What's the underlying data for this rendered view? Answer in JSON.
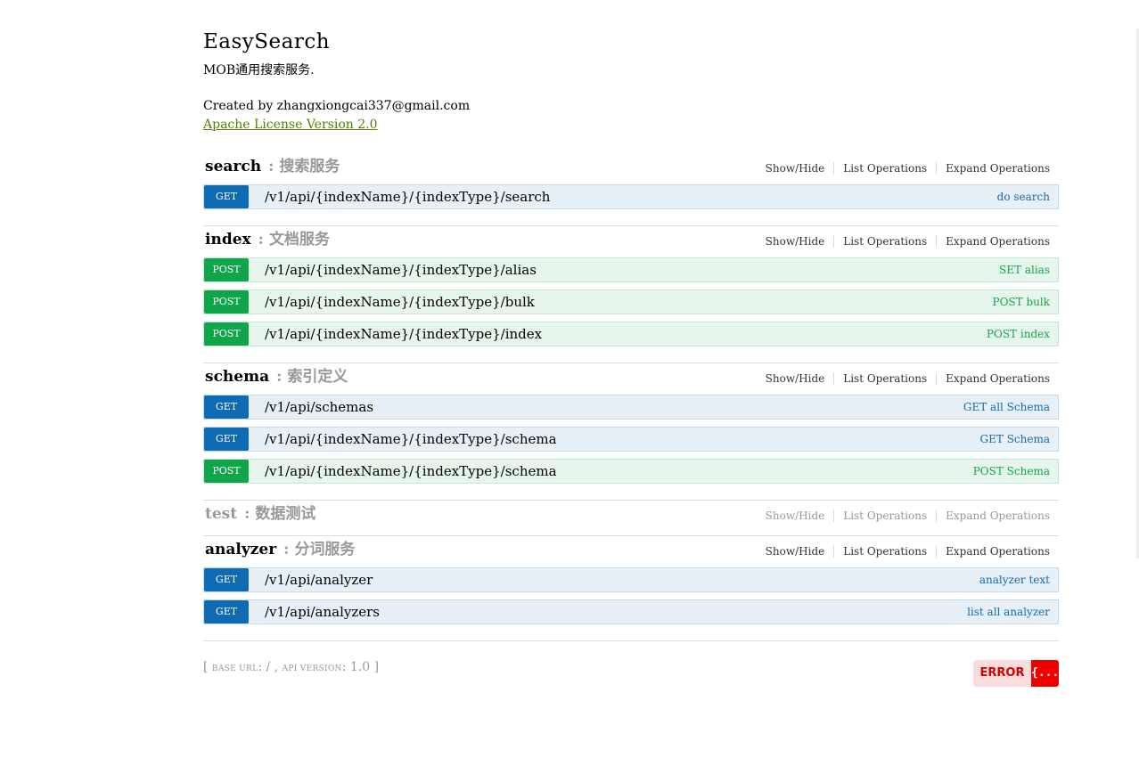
{
  "info": {
    "title": "EasySearch",
    "description": "MOB通用搜索服务.",
    "created": "Created by zhangxiongcai337@gmail.com",
    "license": "Apache License Version 2.0"
  },
  "links": {
    "show_hide": "Show/Hide",
    "list_operations": "List Operations",
    "expand_operations": "Expand Operations"
  },
  "resources": [
    {
      "name": "search",
      "sep": ":",
      "zh": "搜索服务",
      "operations": [
        {
          "method": "GET",
          "path": "/v1/api/{indexName}/{indexType}/search",
          "summary": "do search"
        }
      ]
    },
    {
      "name": "index",
      "sep": ":",
      "zh": "文档服务",
      "operations": [
        {
          "method": "POST",
          "path": "/v1/api/{indexName}/{indexType}/alias",
          "summary": "SET alias"
        },
        {
          "method": "POST",
          "path": "/v1/api/{indexName}/{indexType}/bulk",
          "summary": "POST bulk"
        },
        {
          "method": "POST",
          "path": "/v1/api/{indexName}/{indexType}/index",
          "summary": "POST index"
        }
      ]
    },
    {
      "name": "schema",
      "sep": ":",
      "zh": "索引定义",
      "operations": [
        {
          "method": "GET",
          "path": "/v1/api/schemas",
          "summary": "GET all Schema"
        },
        {
          "method": "GET",
          "path": "/v1/api/{indexName}/{indexType}/schema",
          "summary": "GET Schema"
        },
        {
          "method": "POST",
          "path": "/v1/api/{indexName}/{indexType}/schema",
          "summary": "POST Schema"
        }
      ]
    },
    {
      "name": "test",
      "sep": ":",
      "zh": "数据测试",
      "operations": []
    },
    {
      "name": "analyzer",
      "sep": ":",
      "zh": "分词服务",
      "operations": [
        {
          "method": "GET",
          "path": "/v1/api/analyzer",
          "summary": "analyzer text"
        },
        {
          "method": "GET",
          "path": "/v1/api/analyzers",
          "summary": "list all analyzer"
        }
      ]
    }
  ],
  "footer": {
    "open": "[",
    "base_url_label": "BASE URL",
    "base_url_value": ": / ,",
    "api_version_label": "API VERSION",
    "api_version_value": ": 1.0",
    "close": "]"
  },
  "validator": {
    "label": "ERROR",
    "icon": "{...}"
  },
  "colors": {
    "get": "#0f6ab4",
    "post": "#10a54a",
    "license_link": "#547f00",
    "error": "#ee0000"
  }
}
